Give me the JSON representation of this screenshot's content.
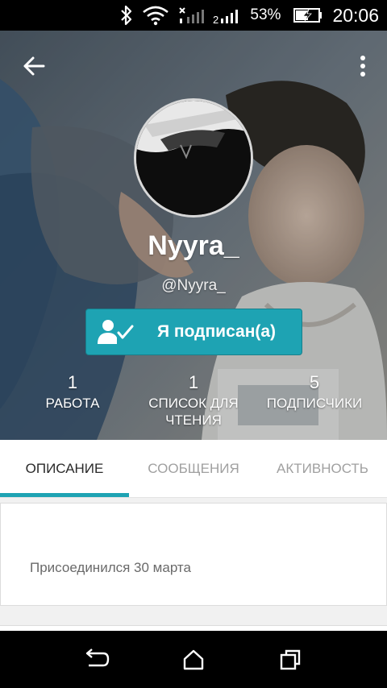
{
  "status_bar": {
    "battery_percent": "53%",
    "time": "20:06",
    "icons": [
      "bluetooth-icon",
      "wifi-icon",
      "signal-icon-1",
      "signal-icon-2",
      "battery-charging-icon"
    ]
  },
  "header": {
    "back_icon": "arrow-left-icon",
    "more_icon": "more-vertical-icon"
  },
  "profile": {
    "display_name": "Nyyra_",
    "handle": "@Nyyra_",
    "follow_button": {
      "label": "Я подписан(а)",
      "icon": "person-check-icon",
      "color": "#1ea3b3"
    },
    "stats": [
      {
        "value": "1",
        "label": "РАБОТА"
      },
      {
        "value": "1",
        "label": "СПИСОК ДЛЯ ЧТЕНИЯ"
      },
      {
        "value": "5",
        "label": "ПОДПИСЧИКИ"
      }
    ]
  },
  "tabs": {
    "items": [
      {
        "label": "ОПИСАНИЕ",
        "active": true
      },
      {
        "label": "СООБЩЕНИЯ",
        "active": false
      },
      {
        "label": "АКТИВНОСТЬ",
        "active": false
      }
    ],
    "indicator_color": "#1ea3b3"
  },
  "about": {
    "joined_text": "Присоединился 30 марта"
  },
  "nav_bar": {
    "icons": [
      "back-nav-icon",
      "home-nav-icon",
      "recents-nav-icon"
    ]
  }
}
